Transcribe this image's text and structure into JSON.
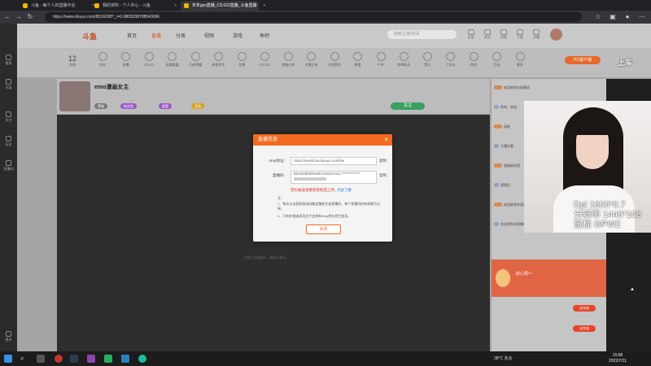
{
  "browser": {
    "tabs": [
      {
        "title": "斗鱼 - 每个人的直播平台"
      },
      {
        "title": "我的资料 - 个人中心 - 斗鱼"
      },
      {
        "title": "年年gxx直播_CS:GO直播_斗鱼直播"
      }
    ],
    "url": "https://www.douyu.com/8516208?_r=0.6805938788543696"
  },
  "leftbar": {
    "items": [
      "推荐",
      "分类",
      "关注",
      "历史",
      "直播间",
      "更多"
    ]
  },
  "header": {
    "logo": "斗鱼",
    "nav": [
      "首页",
      "直播",
      "分类",
      "视频",
      "游戏",
      "鱼吧"
    ],
    "search_placeholder": "搜索主播/房间",
    "icons": [
      "历史",
      "关注",
      "消息",
      "下载",
      "开播"
    ]
  },
  "categories": {
    "count_label": "12",
    "count_sub": "直播",
    "items": [
      "鱼丸",
      "直播",
      "CS:GO",
      "英雄联盟",
      "王者荣耀",
      "绝地求生",
      "主播",
      "DOTA2",
      "穿越火线",
      "主播工具",
      "无畏契约",
      "颜值",
      "户外",
      "吃喝玩乐",
      "音乐",
      "二次元",
      "科技",
      "互动",
      "更多"
    ],
    "pc_button": "PC客户端"
  },
  "room": {
    "title": "emo漫画女主",
    "tags": [
      "等级",
      "粉丝团",
      "超管",
      "活动"
    ],
    "follow_label": "关注"
  },
  "video": {
    "message": "主播正在准备中，请稍后重试"
  },
  "dialog": {
    "title": "直播信息",
    "rtmp_label": "rtmp地址：",
    "rtmp_value": "rtmp://sendtc3a.douyu.com/live",
    "code_label": "直播码：",
    "code_value": "8516208r8ihe69u?wsSecret=*************",
    "copy_label": "复制",
    "warn": "若码被盗请重新获取后上传。",
    "learn_more": "点此了解",
    "notes": [
      "注：",
      "1、每次点击获取推流码都会重新生成直播码，每个直播码的有效期为分钟。",
      "2、只有在推流成功后才会带有rtmp地址发生变化。"
    ],
    "close_label": "关闭"
  },
  "chat": {
    "messages": [
      "欢迎来到本直播间",
      "贵宾：欢迎",
      "清新",
      "主播好看",
      "超级粉丝团",
      "管理员",
      "欢迎来到本直播间",
      "欢迎来到本直播间"
    ],
    "gift_title": "好心情～",
    "action_label": "去完成"
  },
  "cam": {
    "overlay_line1": "Dpi 1600*0.7",
    "overlay_line2": "分辨率 1440*108",
    "overlay_line3": "鼠标 GPW2",
    "corner_text": "上车"
  },
  "taskbar": {
    "weather": "38°C 多云",
    "time": "15:08",
    "date": "2022/7/11"
  }
}
